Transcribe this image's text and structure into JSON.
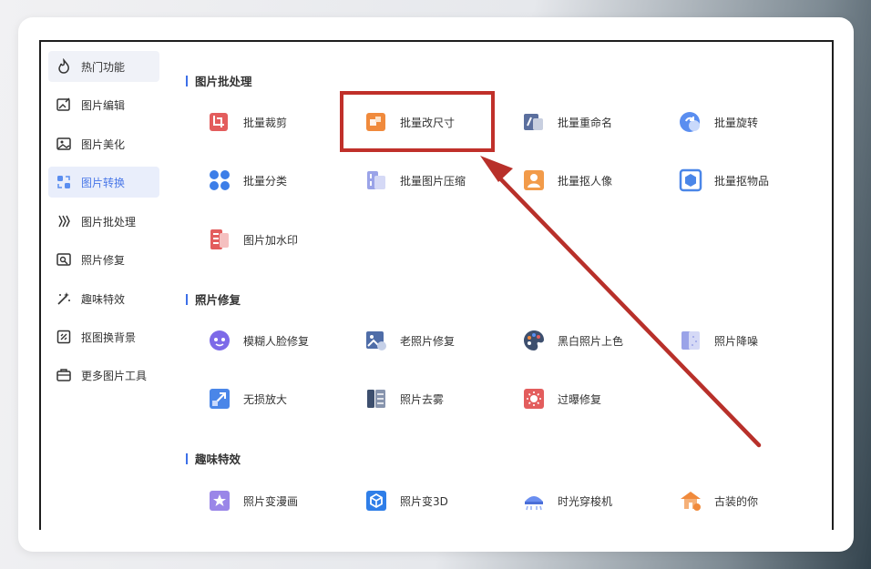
{
  "sidebar": {
    "items": [
      {
        "label": "热门功能",
        "icon": "flame-icon"
      },
      {
        "label": "图片编辑",
        "icon": "image-edit-icon"
      },
      {
        "label": "图片美化",
        "icon": "image-beautify-icon"
      },
      {
        "label": "图片转换",
        "icon": "convert-icon"
      },
      {
        "label": "图片批处理",
        "icon": "batch-icon"
      },
      {
        "label": "照片修复",
        "icon": "photo-repair-icon"
      },
      {
        "label": "趣味特效",
        "icon": "magic-wand-icon"
      },
      {
        "label": "抠图换背景",
        "icon": "cutout-icon"
      },
      {
        "label": "更多图片工具",
        "icon": "toolbox-icon"
      }
    ]
  },
  "sections": {
    "batch": {
      "title": "图片批处理",
      "tools": [
        {
          "label": "批量裁剪",
          "color": "#e35d5d"
        },
        {
          "label": "批量改尺寸",
          "color": "#f08a3c"
        },
        {
          "label": "批量重命名",
          "color": "#5b6f9e"
        },
        {
          "label": "批量旋转",
          "color": "#5a8ef0"
        },
        {
          "label": "批量分类",
          "color": "#3d7ee8"
        },
        {
          "label": "批量图片压缩",
          "color": "#9aa3e8"
        },
        {
          "label": "批量抠人像",
          "color": "#f29b4a"
        },
        {
          "label": "批量抠物品",
          "color": "#4a86e8"
        },
        {
          "label": "图片加水印",
          "color": "#e35d5d"
        }
      ]
    },
    "repair": {
      "title": "照片修复",
      "tools": [
        {
          "label": "模糊人脸修复",
          "color": "#7d6ae8"
        },
        {
          "label": "老照片修复",
          "color": "#4f6da8"
        },
        {
          "label": "黑白照片上色",
          "color": "#3d4f6e"
        },
        {
          "label": "照片降噪",
          "color": "#9aa3e8"
        },
        {
          "label": "无损放大",
          "color": "#4a86e8"
        },
        {
          "label": "照片去雾",
          "color": "#3d4f6e"
        },
        {
          "label": "过曝修复",
          "color": "#e35d5d"
        }
      ]
    },
    "fun": {
      "title": "趣味特效",
      "tools": [
        {
          "label": "照片变漫画",
          "color": "#9a86e8"
        },
        {
          "label": "照片变3D",
          "color": "#2f7ee8"
        },
        {
          "label": "时光穿梭机",
          "color": "#6a8ef0"
        },
        {
          "label": "古装的你",
          "color": "#f08a3c"
        }
      ]
    }
  },
  "colors": {
    "highlight": "#c0302a",
    "accent": "#3d6fe8"
  }
}
